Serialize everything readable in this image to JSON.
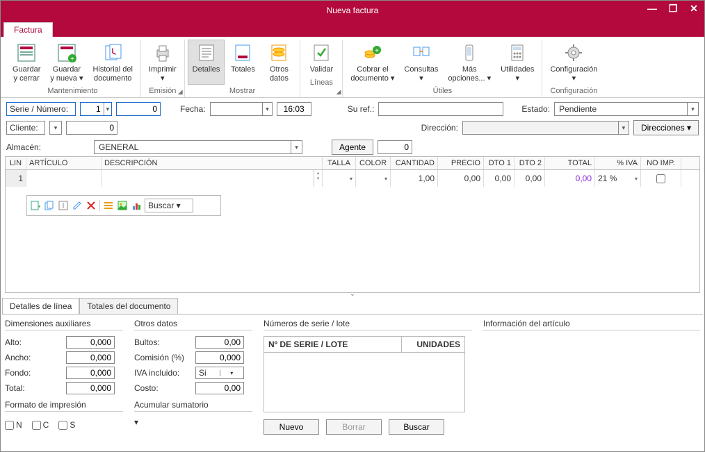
{
  "window": {
    "title": "Nueva factura"
  },
  "tabs": {
    "factura": "Factura"
  },
  "ribbon": {
    "mantenimiento": {
      "label": "Mantenimiento",
      "guardar_cerrar": "Guardar\ny cerrar",
      "guardar_nueva": "Guardar\ny nueva ▾",
      "historial": "Historial del\ndocumento"
    },
    "emision": {
      "label": "Emisión",
      "imprimir": "Imprimir\n▾"
    },
    "mostrar": {
      "label": "Mostrar",
      "detalles": "Detalles",
      "totales": "Totales",
      "otros": "Otros\ndatos"
    },
    "lineas": {
      "label": "Líneas",
      "validar": "Validar"
    },
    "utiles": {
      "label": "Útiles",
      "cobrar": "Cobrar el\ndocumento ▾",
      "consultas": "Consultas\n▾",
      "mas": "Más\nopciones... ▾",
      "utilidades": "Utilidades\n▾"
    },
    "config": {
      "label": "Configuración",
      "config": "Configuración\n▾"
    }
  },
  "form": {
    "serie_label": "Serie / Número:",
    "serie_val": "1",
    "numero_val": "0",
    "fecha_label": "Fecha:",
    "fecha_val": "",
    "hora_val": "16:03",
    "suref_label": "Su ref.:",
    "suref_val": "",
    "estado_label": "Estado:",
    "estado_val": "Pendiente",
    "cliente_label": "Cliente:",
    "cliente_code": "0",
    "direccion_label": "Dirección:",
    "direcciones_btn": "Direcciones ▾",
    "almacen_label": "Almacén:",
    "almacen_val": "GENERAL",
    "agente_btn": "Agente",
    "agente_val": "0"
  },
  "grid": {
    "cols": {
      "lin": "LIN",
      "art": "ARTÍCULO",
      "desc": "DESCRIPCIÓN",
      "talla": "TALLA",
      "color": "COLOR",
      "cant": "CANTIDAD",
      "precio": "PRECIO",
      "dto1": "DTO 1",
      "dto2": "DTO 2",
      "total": "TOTAL",
      "iva": "% IVA",
      "noimp": "NO IMP."
    },
    "row1": {
      "lin": "1",
      "cant": "1,00",
      "precio": "0,00",
      "dto1": "0,00",
      "dto2": "0,00",
      "total": "0,00",
      "iva": "21 %"
    }
  },
  "linetoolbar": {
    "buscar": "Buscar  ▾"
  },
  "btabs": {
    "detalles": "Detalles de línea",
    "totales": "Totales del documento"
  },
  "bottom": {
    "dim_title": "Dimensiones auxiliares",
    "alto": "Alto:",
    "ancho": "Ancho:",
    "fondo": "Fondo:",
    "total": "Total:",
    "alto_v": "0,000",
    "ancho_v": "0,000",
    "fondo_v": "0,000",
    "total_v": "0,000",
    "fmt_title": "Formato de impresión",
    "chk_n": "N",
    "chk_c": "C",
    "chk_s": "S",
    "otros_title": "Otros datos",
    "bultos": "Bultos:",
    "bultos_v": "0,00",
    "comision": "Comisión (%)",
    "comision_v": "0,000",
    "ivainc": "IVA incluido:",
    "ivainc_v": "Si",
    "costo": "Costo:",
    "costo_v": "0,00",
    "acum_title": "Acumular sumatorio",
    "serie_title": "Números de serie / lote",
    "scol1": "Nº DE SERIE / LOTE",
    "scol2": "UNIDADES",
    "nuevo": "Nuevo",
    "borrar": "Borrar",
    "buscar": "Buscar",
    "info_title": "Información del artículo"
  }
}
